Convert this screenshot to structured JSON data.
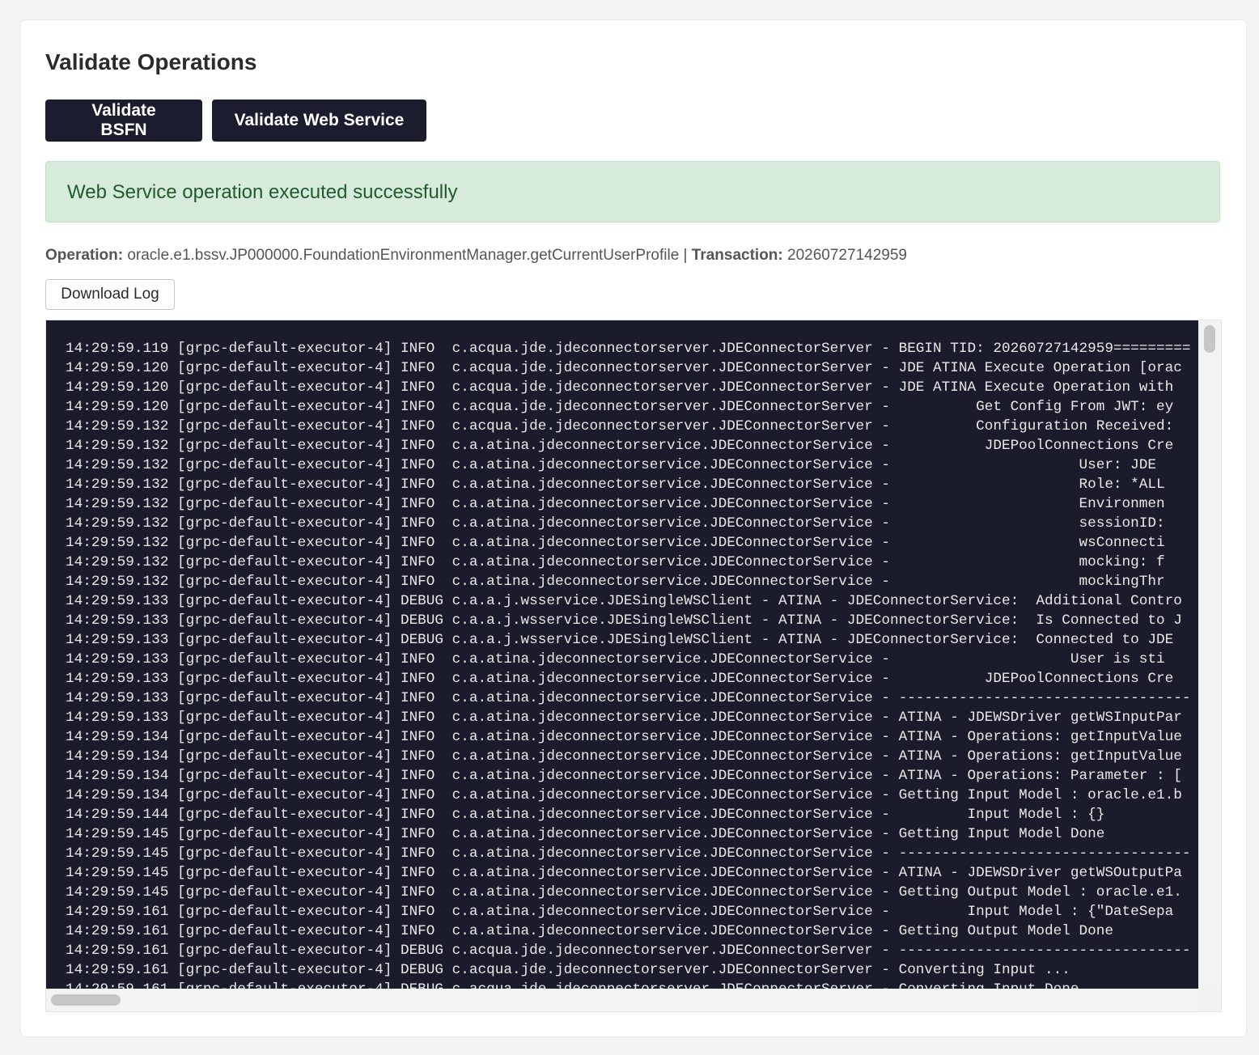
{
  "page": {
    "title": "Validate Operations"
  },
  "buttons": {
    "validate_bsfn": "Validate BSFN",
    "validate_web_service": "Validate Web Service",
    "download_log": "Download Log"
  },
  "alert": {
    "message": "Web Service operation executed successfully",
    "color": "#1f5b2c",
    "background": "#d7ebdc"
  },
  "meta": {
    "operation_label": "Operation:",
    "operation_value": "oracle.e1.bssv.JP000000.FoundationEnvironmentManager.getCurrentUserProfile",
    "separator": "|",
    "transaction_label": "Transaction:",
    "transaction_value": "20260727142959"
  },
  "log": {
    "lines": [
      "14:29:59.119 [grpc-default-executor-4] INFO  c.acqua.jde.jdeconnectorserver.JDEConnectorServer - BEGIN TID: 20260727142959=========",
      "14:29:59.120 [grpc-default-executor-4] INFO  c.acqua.jde.jdeconnectorserver.JDEConnectorServer - JDE ATINA Execute Operation [orac",
      "14:29:59.120 [grpc-default-executor-4] INFO  c.acqua.jde.jdeconnectorserver.JDEConnectorServer - JDE ATINA Execute Operation with",
      "14:29:59.120 [grpc-default-executor-4] INFO  c.acqua.jde.jdeconnectorserver.JDEConnectorServer -          Get Config From JWT: ey",
      "14:29:59.132 [grpc-default-executor-4] INFO  c.acqua.jde.jdeconnectorserver.JDEConnectorServer -          Configuration Received:",
      "14:29:59.132 [grpc-default-executor-4] INFO  c.a.atina.jdeconnectorservice.JDEConnectorService -           JDEPoolConnections Cre",
      "14:29:59.132 [grpc-default-executor-4] INFO  c.a.atina.jdeconnectorservice.JDEConnectorService -                      User: JDE",
      "14:29:59.132 [grpc-default-executor-4] INFO  c.a.atina.jdeconnectorservice.JDEConnectorService -                      Role: *ALL",
      "14:29:59.132 [grpc-default-executor-4] INFO  c.a.atina.jdeconnectorservice.JDEConnectorService -                      Environmen",
      "14:29:59.132 [grpc-default-executor-4] INFO  c.a.atina.jdeconnectorservice.JDEConnectorService -                      sessionID:",
      "14:29:59.132 [grpc-default-executor-4] INFO  c.a.atina.jdeconnectorservice.JDEConnectorService -                      wsConnecti",
      "14:29:59.132 [grpc-default-executor-4] INFO  c.a.atina.jdeconnectorservice.JDEConnectorService -                      mocking: f",
      "14:29:59.132 [grpc-default-executor-4] INFO  c.a.atina.jdeconnectorservice.JDEConnectorService -                      mockingThr",
      "14:29:59.133 [grpc-default-executor-4] DEBUG c.a.a.j.wsservice.JDESingleWSClient - ATINA - JDEConnectorService:  Additional Contro",
      "14:29:59.133 [grpc-default-executor-4] DEBUG c.a.a.j.wsservice.JDESingleWSClient - ATINA - JDEConnectorService:  Is Connected to J",
      "14:29:59.133 [grpc-default-executor-4] DEBUG c.a.a.j.wsservice.JDESingleWSClient - ATINA - JDEConnectorService:  Connected to JDE",
      "14:29:59.133 [grpc-default-executor-4] INFO  c.a.atina.jdeconnectorservice.JDEConnectorService -                     User is sti",
      "14:29:59.133 [grpc-default-executor-4] INFO  c.a.atina.jdeconnectorservice.JDEConnectorService -           JDEPoolConnections Cre",
      "14:29:59.133 [grpc-default-executor-4] INFO  c.a.atina.jdeconnectorservice.JDEConnectorService - ----------------------------------",
      "14:29:59.133 [grpc-default-executor-4] INFO  c.a.atina.jdeconnectorservice.JDEConnectorService - ATINA - JDEWSDriver getWSInputPar",
      "14:29:59.134 [grpc-default-executor-4] INFO  c.a.atina.jdeconnectorservice.JDEConnectorService - ATINA - Operations: getInputValue",
      "14:29:59.134 [grpc-default-executor-4] INFO  c.a.atina.jdeconnectorservice.JDEConnectorService - ATINA - Operations: getInputValue",
      "14:29:59.134 [grpc-default-executor-4] INFO  c.a.atina.jdeconnectorservice.JDEConnectorService - ATINA - Operations: Parameter : [",
      "14:29:59.134 [grpc-default-executor-4] INFO  c.a.atina.jdeconnectorservice.JDEConnectorService - Getting Input Model : oracle.e1.b",
      "14:29:59.144 [grpc-default-executor-4] INFO  c.a.atina.jdeconnectorservice.JDEConnectorService -         Input Model : {}",
      "14:29:59.145 [grpc-default-executor-4] INFO  c.a.atina.jdeconnectorservice.JDEConnectorService - Getting Input Model Done",
      "14:29:59.145 [grpc-default-executor-4] INFO  c.a.atina.jdeconnectorservice.JDEConnectorService - ----------------------------------",
      "14:29:59.145 [grpc-default-executor-4] INFO  c.a.atina.jdeconnectorservice.JDEConnectorService - ATINA - JDEWSDriver getWSOutputPa",
      "14:29:59.145 [grpc-default-executor-4] INFO  c.a.atina.jdeconnectorservice.JDEConnectorService - Getting Output Model : oracle.e1.",
      "14:29:59.161 [grpc-default-executor-4] INFO  c.a.atina.jdeconnectorservice.JDEConnectorService -         Input Model : {\"DateSepa",
      "14:29:59.161 [grpc-default-executor-4] INFO  c.a.atina.jdeconnectorservice.JDEConnectorService - Getting Output Model Done",
      "14:29:59.161 [grpc-default-executor-4] DEBUG c.acqua.jde.jdeconnectorserver.JDEConnectorServer - ----------------------------------",
      "14:29:59.161 [grpc-default-executor-4] DEBUG c.acqua.jde.jdeconnectorserver.JDEConnectorServer - Converting Input ...",
      "14:29:59.161 [grpc-default-executor-4] DEBUG c.acqua.jde.jdeconnectorserver.JDEConnectorServer - Converting Input Done"
    ]
  }
}
